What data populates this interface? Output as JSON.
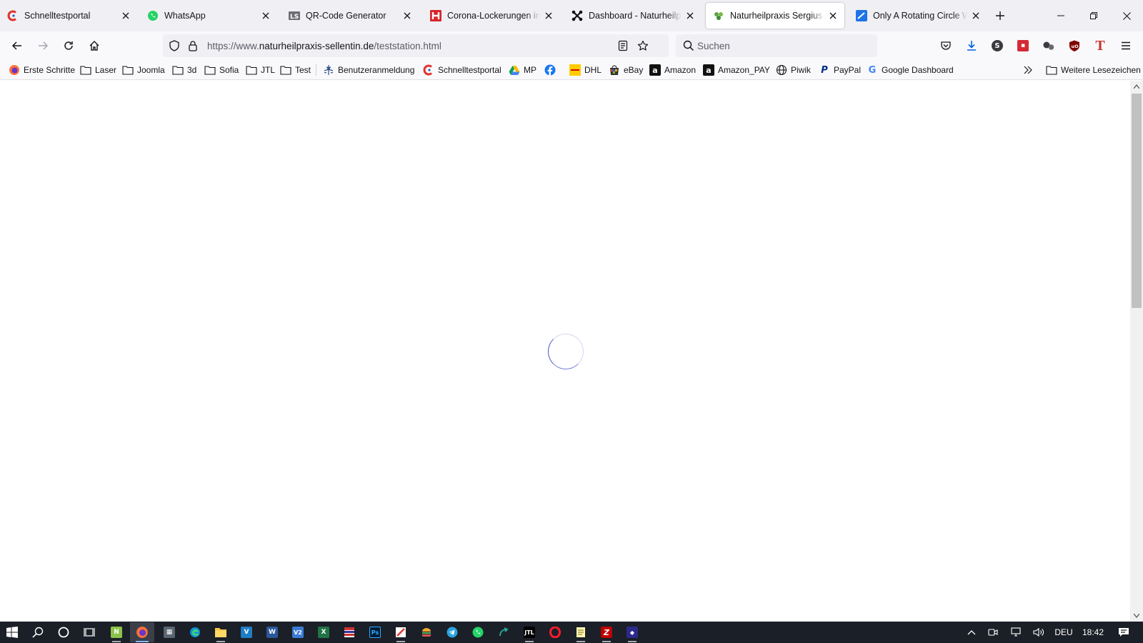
{
  "window": {
    "tabs": [
      {
        "title": "Schnelltestportal",
        "icon": "schnelltest-icon",
        "active": false
      },
      {
        "title": "WhatsApp",
        "icon": "whatsapp-icon",
        "active": false
      },
      {
        "title": "QR-Code Generator",
        "icon": "qr-code-icon",
        "active": false
      },
      {
        "title": "Corona-Lockerungen in Baden-Württemberg",
        "icon": "news-h-icon",
        "active": false
      },
      {
        "title": "Dashboard - Naturheilpraxis",
        "icon": "joomla-icon",
        "active": false
      },
      {
        "title": "Naturheilpraxis Sergius und",
        "icon": "naturheilpraxis-icon",
        "active": true
      },
      {
        "title": "Only A Rotating Circle When",
        "icon": "stack-icon",
        "active": false
      }
    ],
    "new_tab_icon": "plus-icon",
    "controls": [
      "minimize-icon",
      "restore-icon",
      "close-icon"
    ]
  },
  "navbar": {
    "url_prefix": "https://www.",
    "url_host": "naturheilpraxis-sellentin.de",
    "url_path": "/teststation.html",
    "search_placeholder": "Suchen"
  },
  "bookmarks": {
    "items": [
      {
        "label": "Erste Schritte",
        "icon": "firefox-icon"
      },
      {
        "label": "Laser",
        "icon": "folder-icon"
      },
      {
        "label": "Joomla",
        "icon": "folder-icon"
      },
      {
        "label": "3d",
        "icon": "folder-icon"
      },
      {
        "label": "Sofia",
        "icon": "folder-icon"
      },
      {
        "label": "JTL",
        "icon": "folder-icon"
      },
      {
        "label": "Test",
        "icon": "folder-icon"
      },
      {
        "label": "Benutzeranmeldung",
        "icon": "caduceus-icon"
      },
      {
        "label": "Schnelltestportal",
        "icon": "schnelltest-icon"
      },
      {
        "label": "MP",
        "icon": "google-drive-icon"
      },
      {
        "label": "",
        "icon": "facebook-icon"
      },
      {
        "label": "DHL",
        "icon": "dhl-icon"
      },
      {
        "label": "eBay",
        "icon": "ebay-icon"
      },
      {
        "label": "Amazon",
        "icon": "amazon-icon"
      },
      {
        "label": "Amazon_PAY",
        "icon": "amazon-icon"
      },
      {
        "label": "Piwik",
        "icon": "globe-icon"
      },
      {
        "label": "PayPal",
        "icon": "paypal-icon"
      },
      {
        "label": "Google Dashboard",
        "icon": "google-icon"
      }
    ],
    "overflow_icon": "chevrons-right-icon",
    "other_bookmarks": "Weitere Lesezeichen"
  },
  "content": {
    "state": "loading",
    "spinner_color": "#4e56c9"
  },
  "taskbar": {
    "language": "DEU",
    "time": "18:42"
  }
}
